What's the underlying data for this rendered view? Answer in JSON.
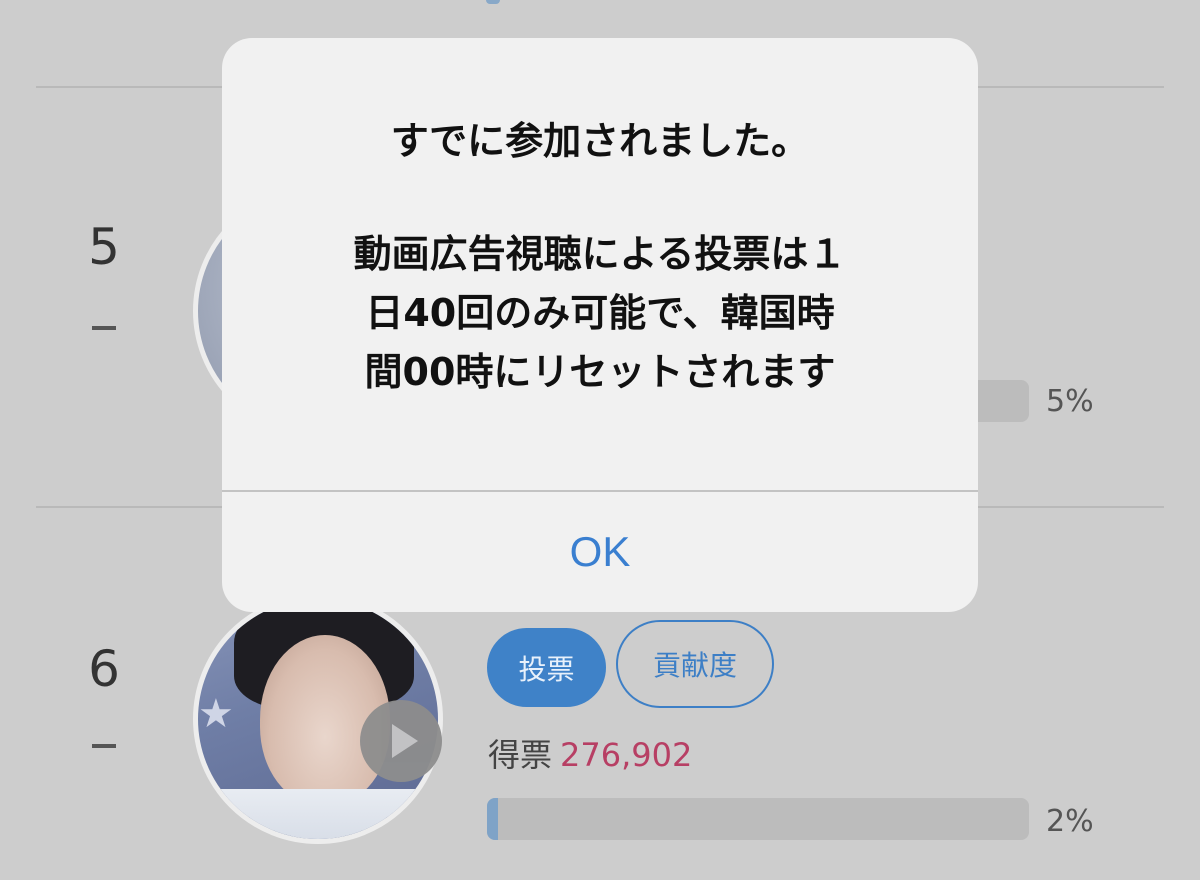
{
  "rows": [
    {
      "rank": "5",
      "change": "-",
      "percent": "5%",
      "progress": 0.05
    },
    {
      "rank": "6",
      "change": "-",
      "vote_label": "投票",
      "contribution_label": "貢献度",
      "votes_label": "得票",
      "votes_count": "276,902",
      "percent": "2%",
      "progress": 0.02
    }
  ],
  "dialog": {
    "title": "すでに参加されました。",
    "message": "動画広告視聴による投票は１\n日40回のみ可能で、韓国時\n間00時にリセットされます",
    "ok_label": "OK"
  },
  "colors": {
    "accent": "#3f82c8",
    "votes": "#b73f64",
    "ok": "#3a7fd0"
  }
}
